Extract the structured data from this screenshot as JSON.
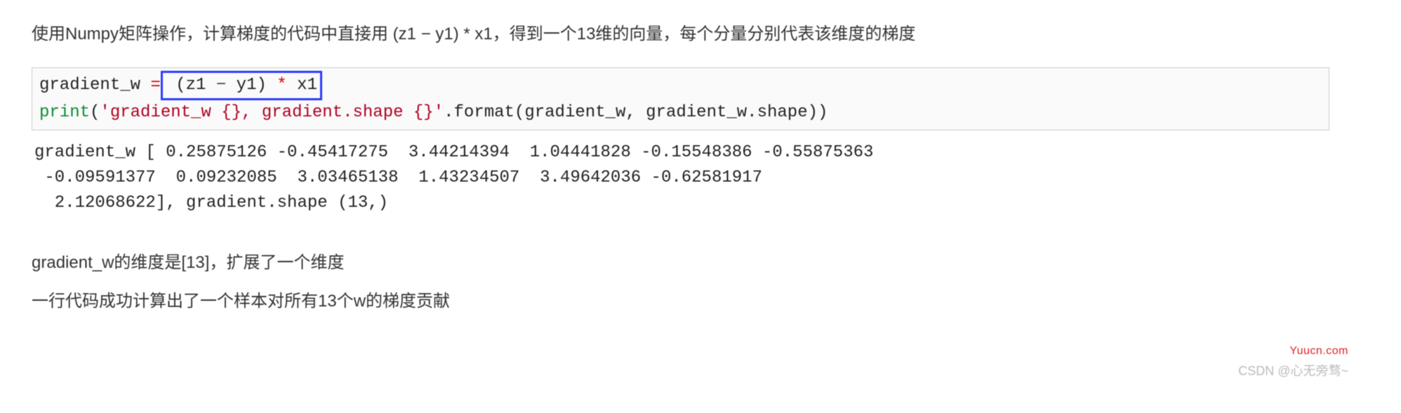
{
  "intro": "使用Numpy矩阵操作，计算梯度的代码中直接用  (z1 − y1) * x1，得到一个13维的向量，每个分量分别代表该维度的梯度",
  "code": {
    "line1_lhs": "gradient_w ",
    "line1_eq": "=",
    "hl_open": " (z1 ",
    "hl_minus": "−",
    "hl_mid": " y1) ",
    "hl_star": "*",
    "hl_close": " x1",
    "line2_print": "print",
    "line2_open": "(",
    "line2_str": "'gradient_w {}, gradient.shape {}'",
    "line2_rest": ".format(gradient_w, gradient_w.shape))"
  },
  "output": {
    "l1": "gradient_w [ 0.25875126 -0.45417275  3.44214394  1.04441828 -0.15548386 -0.55875363",
    "l2": " -0.09591377  0.09232085  3.03465138  1.43234507  3.49642036 -0.62581917",
    "l3": "  2.12068622], gradient.shape (13,)"
  },
  "explain1": "gradient_w的维度是[13]，扩展了一个维度",
  "explain2": "一行代码成功计算出了一个样本对所有13个w的梯度贡献",
  "wm_yuucn": "Yuucn.com",
  "wm_csdn": "CSDN @心无旁骛~"
}
